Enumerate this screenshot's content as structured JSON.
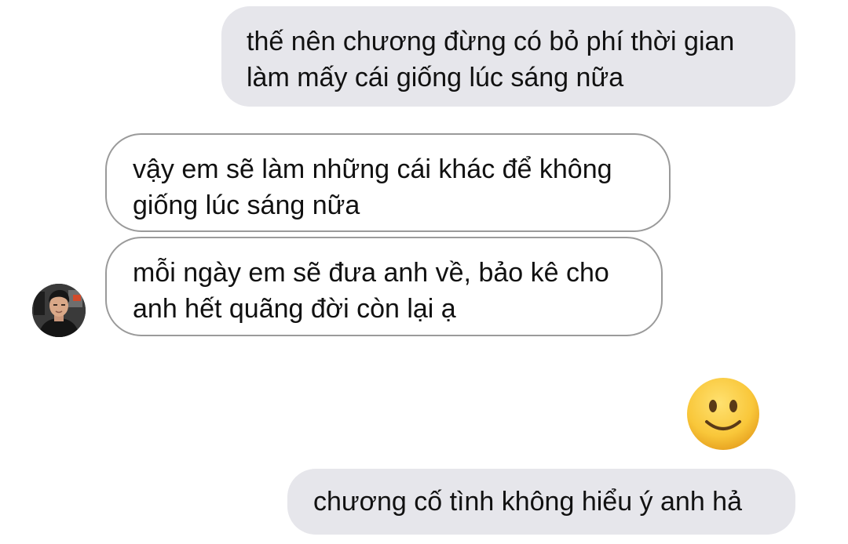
{
  "conversation": {
    "messages": [
      {
        "direction": "outgoing",
        "text": "thế nên chương đừng có bỏ phí thời gian\nlàm mấy cái giống lúc sáng nữa"
      },
      {
        "direction": "incoming",
        "text": "vậy em sẽ làm những cái khác để không\ngiống lúc sáng nữa"
      },
      {
        "direction": "incoming",
        "text": "mỗi ngày em sẽ đưa anh về, bảo kê cho\nanh hết quãng đời còn lại ạ"
      },
      {
        "direction": "outgoing",
        "emoji": "slightly-smiling-face-icon"
      },
      {
        "direction": "outgoing",
        "text": "chương cố tình không hiểu ý anh hả"
      }
    ],
    "contact_avatar": "contact-avatar",
    "colors": {
      "outgoing_bubble": "#e6e6eb",
      "incoming_border": "#9a9a9a",
      "text": "#111111",
      "emoji_face": "#f7c531"
    }
  }
}
